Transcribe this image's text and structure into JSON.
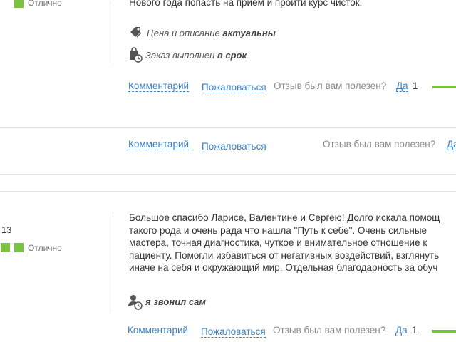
{
  "review1": {
    "rating_text": "Отлично",
    "text_tail": "Нового года попасть на прием и пройти курс чисток.",
    "meta": [
      {
        "icon": "price-tag-icon",
        "prefix": "Цена и описание",
        "value": "актуальны"
      },
      {
        "icon": "bag-clock-icon",
        "prefix": "Заказ выполнен",
        "value": "в срок"
      }
    ],
    "comment_label": "Комментарий",
    "complain_label": "Пожаловаться",
    "useful_label": "Отзыв был вам полезен?",
    "yes_label": "Да",
    "yes_count": "1"
  },
  "reply1": {
    "comment_label": "Комментарий",
    "complain_label": "Пожаловаться",
    "useful_label": "Отзыв был вам полезен?",
    "yes_label": "Да"
  },
  "review2": {
    "date_fragment": "13",
    "rating_text": "Отлично",
    "text_lines": [
      "Большое спасибо Ларисе, Валентине и Сергею! Долго искала помощ",
      "такого рода и очень рада что нашла \"Путь к себе\". Очень сильные",
      "мастера, точная диагностика, чуткое и внимательное отношение к",
      "пациенту. Помогли избавиться от негативных воздействий, взглянуть",
      "иначе на себя и окружающий мир. Отдельная благодарность за обуч"
    ],
    "meta": [
      {
        "icon": "person-clock-icon",
        "value": "я звонил сам"
      }
    ],
    "comment_label": "Комментарий",
    "complain_label": "Пожаловаться",
    "useful_label": "Отзыв был вам полезен?",
    "yes_label": "Да",
    "yes_count": "1"
  },
  "colors": {
    "accent_green": "#7bc142",
    "link_blue": "#3b7fc4",
    "divider": "#e3e3e3"
  }
}
